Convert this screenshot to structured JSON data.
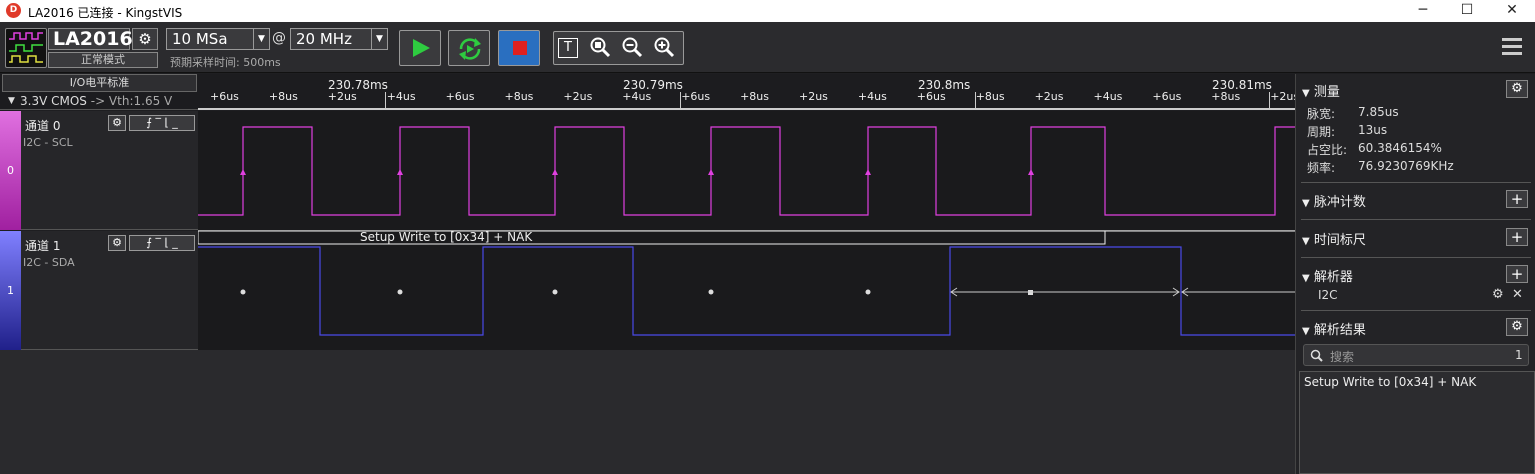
{
  "window": {
    "title": "LA2016 已连接 - KingstVIS",
    "logo": "D",
    "minimize": "─",
    "maximize": "☐",
    "close": "✕"
  },
  "toolbar": {
    "device_name": "LA2016",
    "device_mode": "正常模式",
    "sample_depth": "10 MSa",
    "at_symbol": "@",
    "sample_rate": "20 MHz",
    "sample_time_hint": "预期采样时间: 500ms",
    "buttons": {
      "start": "start",
      "loop": "loop",
      "stop": "stop"
    },
    "tools": {
      "text": "T",
      "zoom_fit": "🔍",
      "zoom_out": "−",
      "zoom_in": "+"
    }
  },
  "io": {
    "label": "I/O电平标准",
    "standard": "3.3V CMOS",
    "vth": "-> Vth:1.65 V"
  },
  "ruler": {
    "major": [
      "230.78ms",
      "230.79ms",
      "230.8ms",
      "230.81ms"
    ],
    "minor": [
      "+6us",
      "+8us",
      "+2us",
      "+4us",
      "+6us",
      "+8us",
      "+2us",
      "+4us",
      "+6us",
      "+8us",
      "+2us",
      "+4us",
      "+6us",
      "+8us",
      "+2us",
      "+4us",
      "+6us",
      "+8us",
      "+2us"
    ]
  },
  "channels": [
    {
      "name": "通道 0",
      "sub": "I2C - SCL",
      "index": "0",
      "color": "#cc33cc",
      "wave": "#e040e0"
    },
    {
      "name": "通道 1",
      "sub": "I2C - SDA",
      "index": "1",
      "color": "#3a3aa8",
      "wave": "#4a4ae8"
    }
  ],
  "channel_buttons": {
    "gear": "⚙",
    "edge": "⨍ ‾ ⌊ _"
  },
  "decode_label": "Setup Write to [0x34] + NAK",
  "side": {
    "measure_title": "测量",
    "measure": [
      {
        "k": "脉宽:",
        "v": "7.85us"
      },
      {
        "k": "周期:",
        "v": "13us"
      },
      {
        "k": "占空比:",
        "v": "60.3846154%"
      },
      {
        "k": "频率:",
        "v": "76.9230769KHz"
      }
    ],
    "pulse_count": "脉冲计数",
    "time_ruler": "时间标尺",
    "analyzer": "解析器",
    "analyzer_item": "I2C",
    "results_title": "解析结果",
    "search_placeholder": "搜索",
    "search_count": "1",
    "result_rows": [
      "Setup Write to [0x34] + NAK"
    ],
    "arrow": "▼",
    "plus": "+",
    "gear": "⚙",
    "close": "✕"
  },
  "colors": {
    "accent_green": "#2ecc40",
    "stop_red": "#e02020",
    "stop_bg": "#2a6fc0"
  }
}
